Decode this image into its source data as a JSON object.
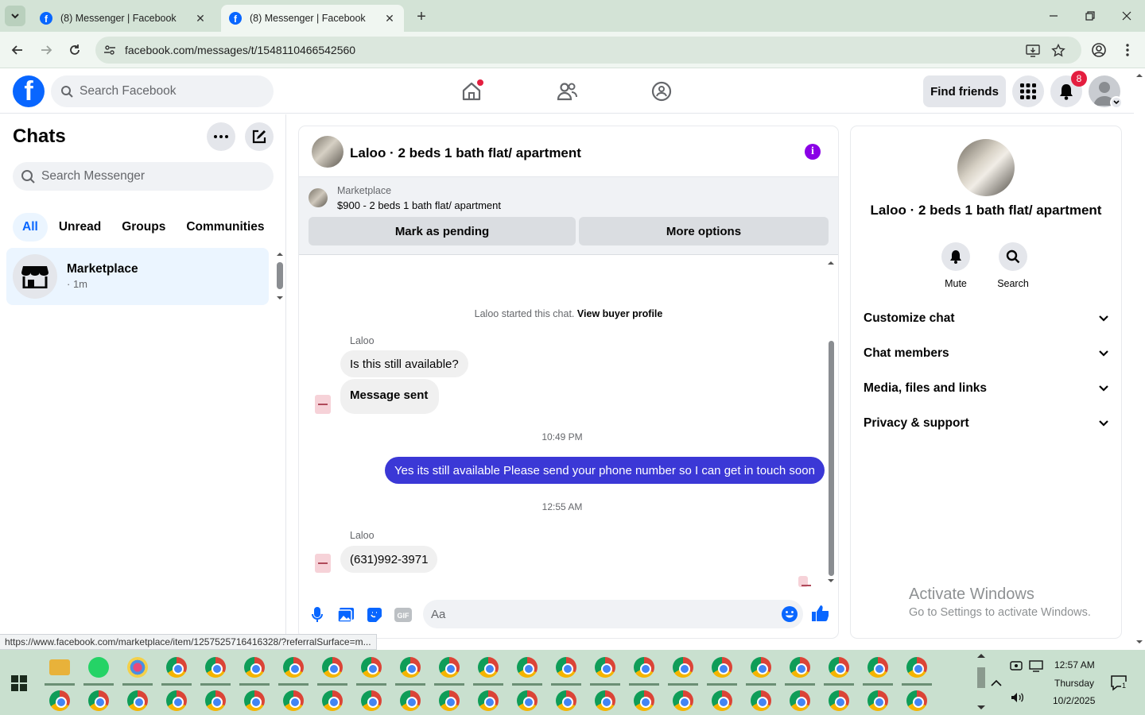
{
  "browser": {
    "tabs": [
      {
        "title": "(8) Messenger | Facebook",
        "active": false
      },
      {
        "title": "(8) Messenger | Facebook",
        "active": true
      }
    ],
    "url": "facebook.com/messages/t/1548110466542560",
    "status_url": "https://www.facebook.com/marketplace/item/1257525716416328/?referralSurface=m..."
  },
  "fb_header": {
    "search_placeholder": "Search Facebook",
    "find_friends_label": "Find friends",
    "notifications_count": "8",
    "home_has_dot": true
  },
  "chats": {
    "title": "Chats",
    "search_placeholder": "Search Messenger",
    "filters": [
      "All",
      "Unread",
      "Groups",
      "Communities"
    ],
    "active_filter": "All",
    "items": [
      {
        "name": "Marketplace",
        "time": "· 1m"
      }
    ]
  },
  "conversation": {
    "title": "Laloo · 2 beds 1 bath flat/ apartment",
    "marketplace_label": "Marketplace",
    "listing": "$900 - 2 beds 1 bath flat/ apartment",
    "mark_pending_label": "Mark as pending",
    "more_options_label": "More options",
    "system_text": "Laloo started this chat.",
    "system_link": "View buyer profile",
    "messages": [
      {
        "sender": "Laloo",
        "text": "Is this still available?",
        "direction": "in"
      },
      {
        "text": "Message sent",
        "direction": "in"
      },
      {
        "timestamp": "10:49 PM"
      },
      {
        "text": "Yes its still available Please send your phone number so I can get in touch soon",
        "direction": "out"
      },
      {
        "timestamp": "12:55 AM"
      },
      {
        "sender": "Laloo",
        "text": "(631)992-3971",
        "direction": "in"
      }
    ],
    "composer_placeholder": "Aa",
    "accent_color": "#3b38d6"
  },
  "details": {
    "name": "Laloo · 2 beds 1 bath flat/ apartment",
    "actions": [
      {
        "label": "Mute",
        "icon": "bell-icon"
      },
      {
        "label": "Search",
        "icon": "search-icon"
      }
    ],
    "sections": [
      "Customize chat",
      "Chat members",
      "Media, files and links",
      "Privacy & support"
    ]
  },
  "watermark": {
    "line1": "Activate Windows",
    "line2": "Go to Settings to activate Windows."
  },
  "taskbar": {
    "time": "12:57 AM",
    "day": "Thursday",
    "date": "10/2/2025",
    "notification_count": "1"
  }
}
